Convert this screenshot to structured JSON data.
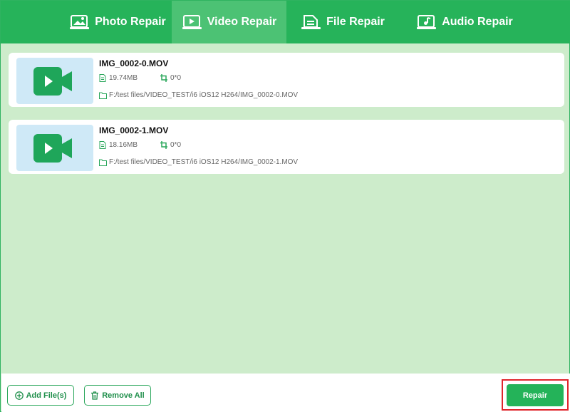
{
  "tabs": [
    {
      "label": "Photo Repair",
      "icon": "photo-repair-icon",
      "active": false
    },
    {
      "label": "Video Repair",
      "icon": "video-repair-icon",
      "active": true
    },
    {
      "label": "File Repair",
      "icon": "file-repair-icon",
      "active": false
    },
    {
      "label": "Audio Repair",
      "icon": "audio-repair-icon",
      "active": false
    }
  ],
  "files": [
    {
      "name": "IMG_0002-0.MOV",
      "size": "19.74MB",
      "resolution": "0*0",
      "path": "F:/test files/VIDEO_TEST/i6 iOS12 H264/IMG_0002-0.MOV"
    },
    {
      "name": "IMG_0002-1.MOV",
      "size": "18.16MB",
      "resolution": "0*0",
      "path": "F:/test files/VIDEO_TEST/i6 iOS12 H264/IMG_0002-1.MOV"
    }
  ],
  "actions": {
    "add_files": "Add File(s)",
    "remove_all": "Remove All",
    "repair": "Repair"
  },
  "colors": {
    "primary": "#26b35a",
    "tab_active": "#4cc274",
    "content_bg": "#cdeccb",
    "highlight": "#e0242c"
  }
}
